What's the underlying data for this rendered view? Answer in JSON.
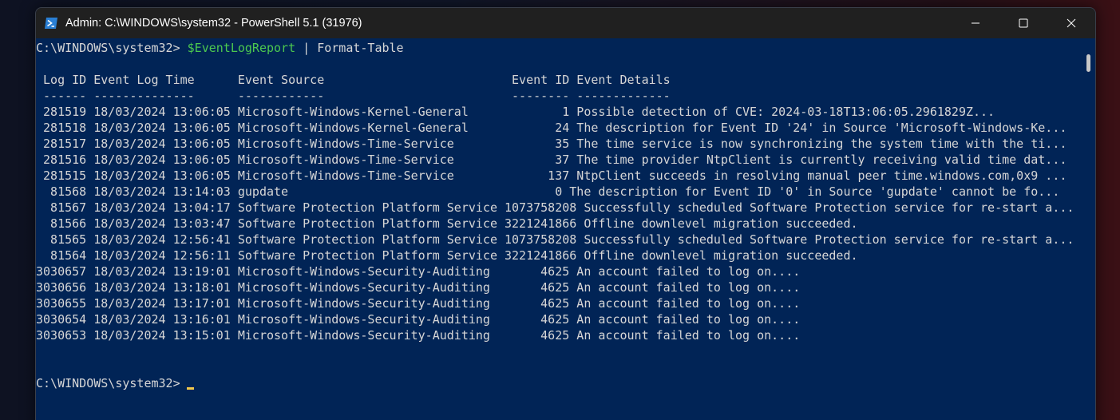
{
  "window": {
    "title": "Admin: C:\\WINDOWS\\system32 - PowerShell 5.1 (31976)",
    "icon": "powershell-icon",
    "controls": {
      "minimize": "minimize-icon",
      "maximize": "maximize-icon",
      "close": "close-icon"
    }
  },
  "colors": {
    "console_bg": "#012456",
    "variable": "#4cc94f",
    "text": "#d6d6d6",
    "cursor": "#f2c94c"
  },
  "console": {
    "prompt": "C:\\WINDOWS\\system32> ",
    "command_variable": "$EventLogReport",
    "command_rest": " | Format-Table",
    "table_header": " Log ID Event Log Time      Event Source                          Event ID Event Details",
    "table_divider": " ------ --------------      ------------                          -------- -------------",
    "rows": [
      " 281519 18/03/2024 13:06:05 Microsoft-Windows-Kernel-General             1 Possible detection of CVE: 2024-03-18T13:06:05.2961829Z...",
      " 281518 18/03/2024 13:06:05 Microsoft-Windows-Kernel-General            24 The description for Event ID '24' in Source 'Microsoft-Windows-Ke...",
      " 281517 18/03/2024 13:06:05 Microsoft-Windows-Time-Service              35 The time service is now synchronizing the system time with the ti...",
      " 281516 18/03/2024 13:06:05 Microsoft-Windows-Time-Service              37 The time provider NtpClient is currently receiving valid time dat...",
      " 281515 18/03/2024 13:06:05 Microsoft-Windows-Time-Service             137 NtpClient succeeds in resolving manual peer time.windows.com,0x9 ...",
      "  81568 18/03/2024 13:14:03 gupdate                                     0 The description for Event ID '0' in Source 'gupdate' cannot be fo...",
      "  81567 18/03/2024 13:04:17 Software Protection Platform Service 1073758208 Successfully scheduled Software Protection service for re-start a...",
      "  81566 18/03/2024 13:03:47 Software Protection Platform Service 3221241866 Offline downlevel migration succeeded.",
      "  81565 18/03/2024 12:56:41 Software Protection Platform Service 1073758208 Successfully scheduled Software Protection service for re-start a...",
      "  81564 18/03/2024 12:56:11 Software Protection Platform Service 3221241866 Offline downlevel migration succeeded.",
      "3030657 18/03/2024 13:19:01 Microsoft-Windows-Security-Auditing       4625 An account failed to log on....",
      "3030656 18/03/2024 13:18:01 Microsoft-Windows-Security-Auditing       4625 An account failed to log on....",
      "3030655 18/03/2024 13:17:01 Microsoft-Windows-Security-Auditing       4625 An account failed to log on....",
      "3030654 18/03/2024 13:16:01 Microsoft-Windows-Security-Auditing       4625 An account failed to log on....",
      "3030653 18/03/2024 13:15:01 Microsoft-Windows-Security-Auditing       4625 An account failed to log on...."
    ],
    "final_prompt": "C:\\WINDOWS\\system32>"
  }
}
